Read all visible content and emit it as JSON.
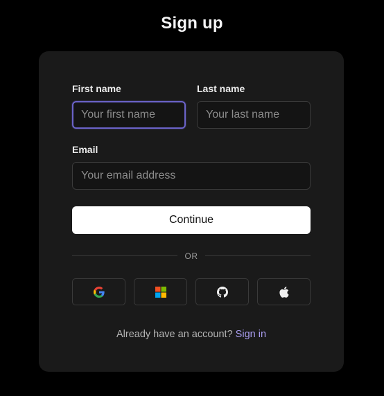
{
  "page": {
    "title": "Sign up"
  },
  "form": {
    "first_name": {
      "label": "First name",
      "placeholder": "Your first name",
      "value": ""
    },
    "last_name": {
      "label": "Last name",
      "placeholder": "Your last name",
      "value": ""
    },
    "email": {
      "label": "Email",
      "placeholder": "Your email address",
      "value": ""
    },
    "continue_label": "Continue",
    "divider_text": "OR"
  },
  "social": [
    {
      "icon": "google-icon"
    },
    {
      "icon": "microsoft-icon"
    },
    {
      "icon": "github-icon"
    },
    {
      "icon": "apple-icon"
    }
  ],
  "footer": {
    "prompt": "Already have an account?",
    "link_label": "Sign in"
  },
  "colors": {
    "background": "#000000",
    "card": "#1a1a1a",
    "focus_ring": "#6b63c9",
    "link": "#a99df0"
  }
}
